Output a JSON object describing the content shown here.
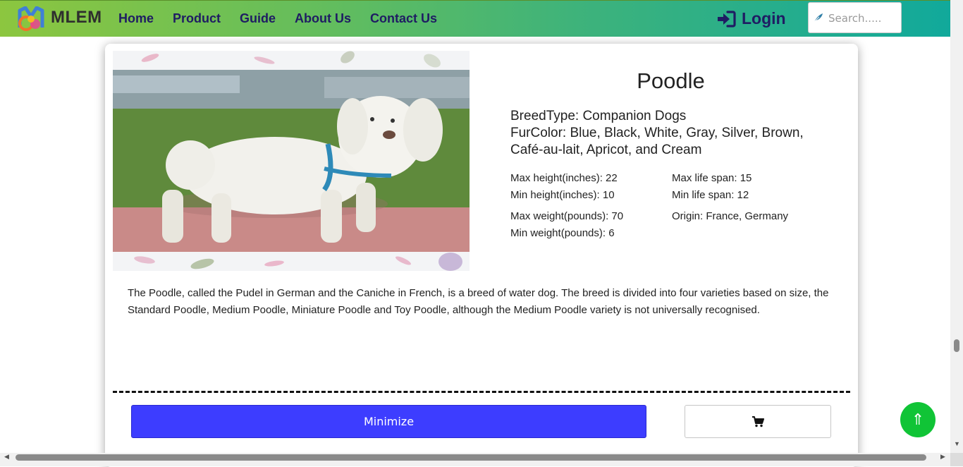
{
  "nav": {
    "brand": "MLEM",
    "links": [
      "Home",
      "Product",
      "Guide",
      "About Us",
      "Contact Us"
    ],
    "login_label": "Login",
    "search_placeholder": "Search....."
  },
  "breed": {
    "name": "Poodle",
    "breed_type": "BreedType: Companion Dogs",
    "fur_color": "FurColor: Blue, Black, White, Gray, Silver, Brown, Café-au-lait, Apricot, and Cream",
    "max_height": "Max height(inches): 22",
    "min_height": "Min height(inches): 10",
    "max_life": "Max life span: 15",
    "min_life": "Min life span: 12",
    "max_weight": "Max weight(pounds): 70",
    "min_weight": "Min weight(pounds): 6",
    "origin": "Origin: France, Germany",
    "description": "The Poodle, called the Pudel in German and the Caniche in French, is a breed of water dog. The breed is divided into four varieties based on size, the Standard Poodle, Medium Poodle, Miniature Poodle and Toy Poodle, although the Medium Poodle variety is not universally recognised."
  },
  "actions": {
    "minimize_label": "Minimize",
    "cart_icon": "cart-icon",
    "scroll_top_icon": "double-arrow-up-icon"
  },
  "colors": {
    "nav_gradient_start": "#8cc63f",
    "nav_gradient_end": "#11a99b",
    "nav_text": "#1f1c63",
    "minimize_button": "#3d3dff",
    "scroll_top_button": "#10c436"
  }
}
